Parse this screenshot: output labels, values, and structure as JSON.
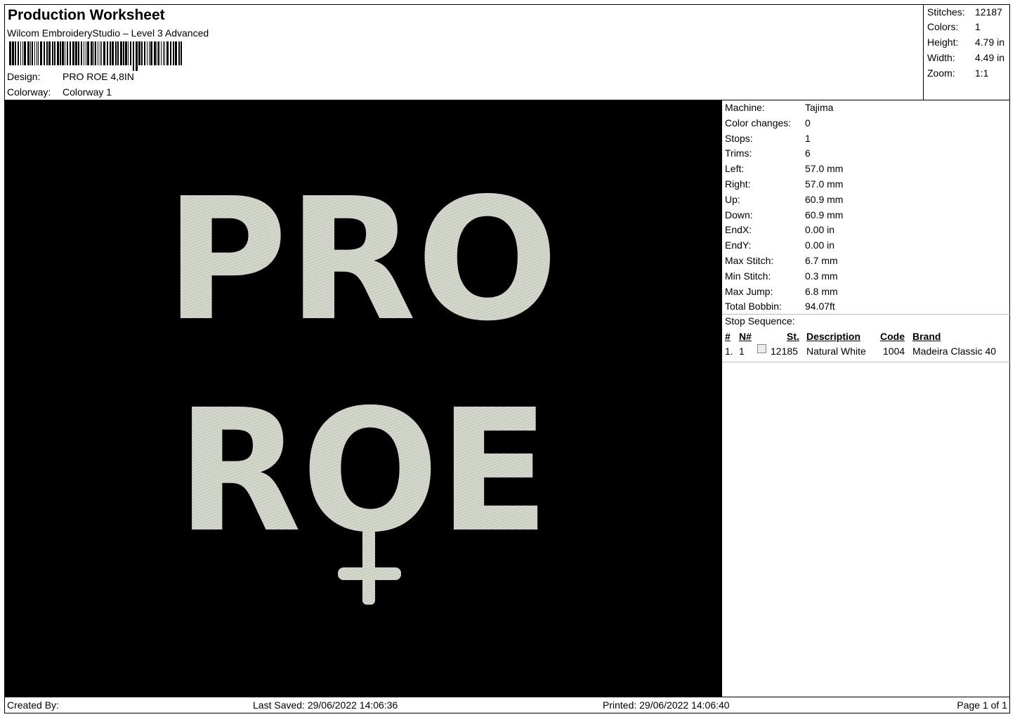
{
  "header": {
    "title": "Production Worksheet",
    "software": "Wilcom EmbroideryStudio – Level 3 Advanced",
    "design_label": "Design:",
    "design_value": "PRO ROE 4,8IN",
    "colorway_label": "Colorway:",
    "colorway_value": "Colorway 1"
  },
  "summary": {
    "stitches_label": "Stitches:",
    "stitches_value": "12187",
    "colors_label": "Colors:",
    "colors_value": "1",
    "height_label": "Height:",
    "height_value": "4.79 in",
    "width_label": "Width:",
    "width_value": "4.49 in",
    "zoom_label": "Zoom:",
    "zoom_value": "1:1"
  },
  "design_preview": {
    "line1": "PRO",
    "line2": "ROE",
    "thread_color": "#d3d7cc",
    "background": "#000000"
  },
  "machine": [
    {
      "label": "Machine:",
      "value": "Tajima"
    },
    {
      "label": "Color changes:",
      "value": "0"
    },
    {
      "label": "Stops:",
      "value": "1"
    },
    {
      "label": "Trims:",
      "value": "6"
    },
    {
      "label": "Left:",
      "value": "57.0 mm"
    },
    {
      "label": "Right:",
      "value": "57.0 mm"
    },
    {
      "label": "Up:",
      "value": "60.9 mm"
    },
    {
      "label": "Down:",
      "value": "60.9 mm"
    },
    {
      "label": "EndX:",
      "value": "0.00 in"
    },
    {
      "label": "EndY:",
      "value": "0.00 in"
    },
    {
      "label": "Max Stitch:",
      "value": "6.7 mm"
    },
    {
      "label": "Min Stitch:",
      "value": "0.3 mm"
    },
    {
      "label": "Max Jump:",
      "value": "6.8 mm"
    },
    {
      "label": "Total Bobbin:",
      "value": "94.07ft"
    }
  ],
  "stop_sequence": {
    "label": "Stop Sequence:",
    "columns": [
      "#",
      "N#",
      "St.",
      "Description",
      "Code",
      "Brand"
    ],
    "rows": [
      {
        "index": "1.",
        "n": "1",
        "swatch": "#ececec",
        "stitches": "12185",
        "description": "Natural White",
        "code": "1004",
        "brand": "Madeira Classic 40"
      }
    ]
  },
  "footer": {
    "created_by": "Created By:",
    "last_saved": "Last Saved: 29/06/2022 14:06:36",
    "printed": "Printed: 29/06/2022 14:06:40",
    "page": "Page 1 of 1"
  }
}
